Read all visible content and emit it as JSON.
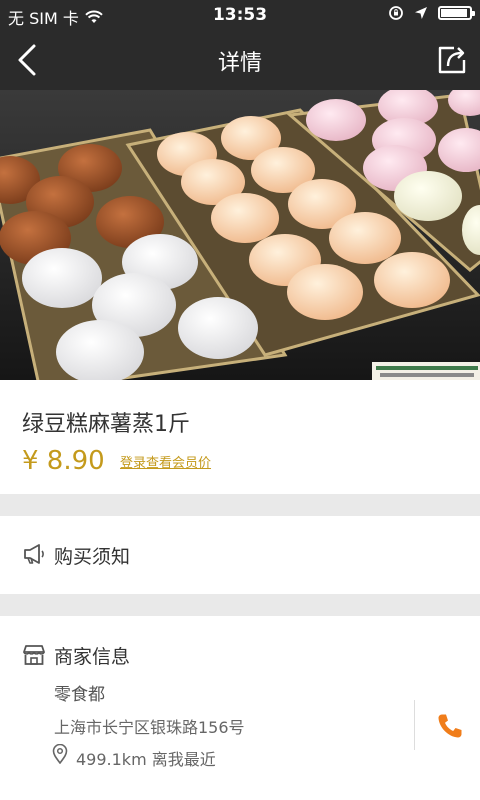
{
  "status_bar": {
    "carrier": "无 SIM 卡",
    "time": "13:53",
    "icons": [
      "wifi-icon",
      "rotation-lock-icon",
      "location-arrow-icon",
      "battery-icon"
    ]
  },
  "nav": {
    "title": "详情",
    "back_icon": "chevron-left-icon",
    "share_icon": "share-icon"
  },
  "hero": {
    "image_label": "",
    "image_alt": "麻薯甜点陈列"
  },
  "product": {
    "title": "绿豆糕麻薯蒸1斤",
    "price": "¥ 8.90",
    "member_link": "登录查看会员价"
  },
  "notice": {
    "label": "购买须知",
    "icon": "megaphone-icon"
  },
  "merchant": {
    "heading": "商家信息",
    "icon": "store-icon",
    "name": "零食都",
    "address": "上海市长宁区银珠路156号",
    "distance": "499.1km 离我最近",
    "phone_icon": "phone-icon"
  },
  "colors": {
    "bar_bg": "#2b2b2b",
    "accent": "#c49a1c",
    "phone": "#f07d1a",
    "page_bg": "#efefef"
  }
}
